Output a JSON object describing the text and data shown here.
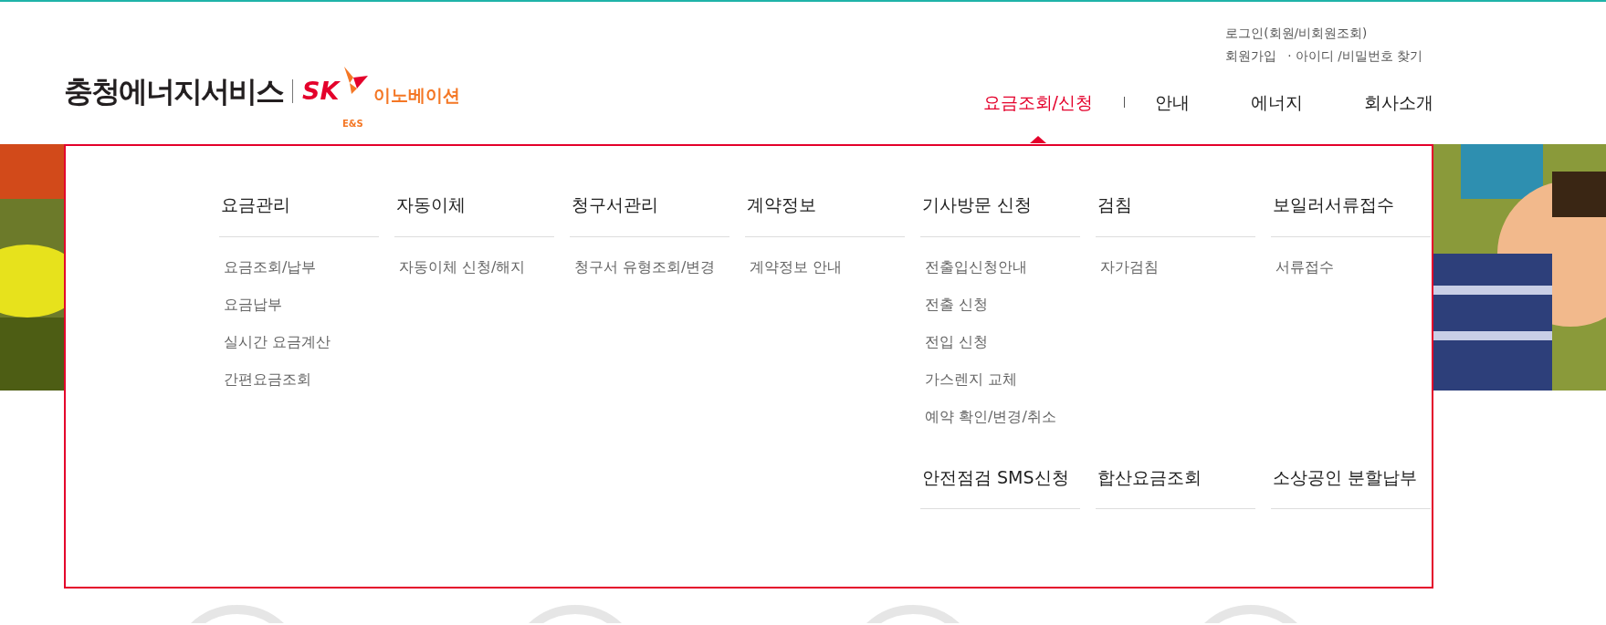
{
  "logo": {
    "name": "충청에너지서비스",
    "brand": "SK",
    "sub": "이노베이션",
    "suffix": "E&S"
  },
  "top_links": [
    {
      "label": "로그인(회원/비회원조회)"
    },
    {
      "label": "회원가입"
    },
    {
      "label": "· 아이디 /비밀번호 찾기"
    }
  ],
  "nav": [
    {
      "label": "요금조회/신청",
      "selected": true
    },
    {
      "label": "안내",
      "selected": false
    },
    {
      "label": "에너지",
      "selected": false
    },
    {
      "label": "회사소개",
      "selected": false
    }
  ],
  "menu": {
    "columns": [
      {
        "groups": [
          {
            "title": "요금관리",
            "items": [
              "요금조회/납부",
              "요금납부",
              "실시간 요금계산",
              "간편요금조회"
            ]
          }
        ]
      },
      {
        "groups": [
          {
            "title": "자동이체",
            "items": [
              "자동이체 신청/해지"
            ]
          }
        ]
      },
      {
        "groups": [
          {
            "title": "청구서관리",
            "items": [
              "청구서 유형조회/변경"
            ]
          }
        ]
      },
      {
        "groups": [
          {
            "title": "계약정보",
            "items": [
              "계약정보 안내"
            ]
          }
        ]
      },
      {
        "groups": [
          {
            "title": "기사방문 신청",
            "items": [
              "전출입신청안내",
              "전출 신청",
              "전입 신청",
              "가스렌지 교체",
              "예약 확인/변경/취소"
            ]
          },
          {
            "title": "안전점검 SMS신청"
          }
        ]
      },
      {
        "groups": [
          {
            "title": "검침",
            "items": [
              "자가검침"
            ]
          },
          {
            "title": "합산요금조회"
          }
        ]
      },
      {
        "groups": [
          {
            "title": "보일러서류접수",
            "items": [
              "서류접수"
            ]
          },
          {
            "title": "소상공인 분할납부"
          }
        ]
      }
    ]
  }
}
